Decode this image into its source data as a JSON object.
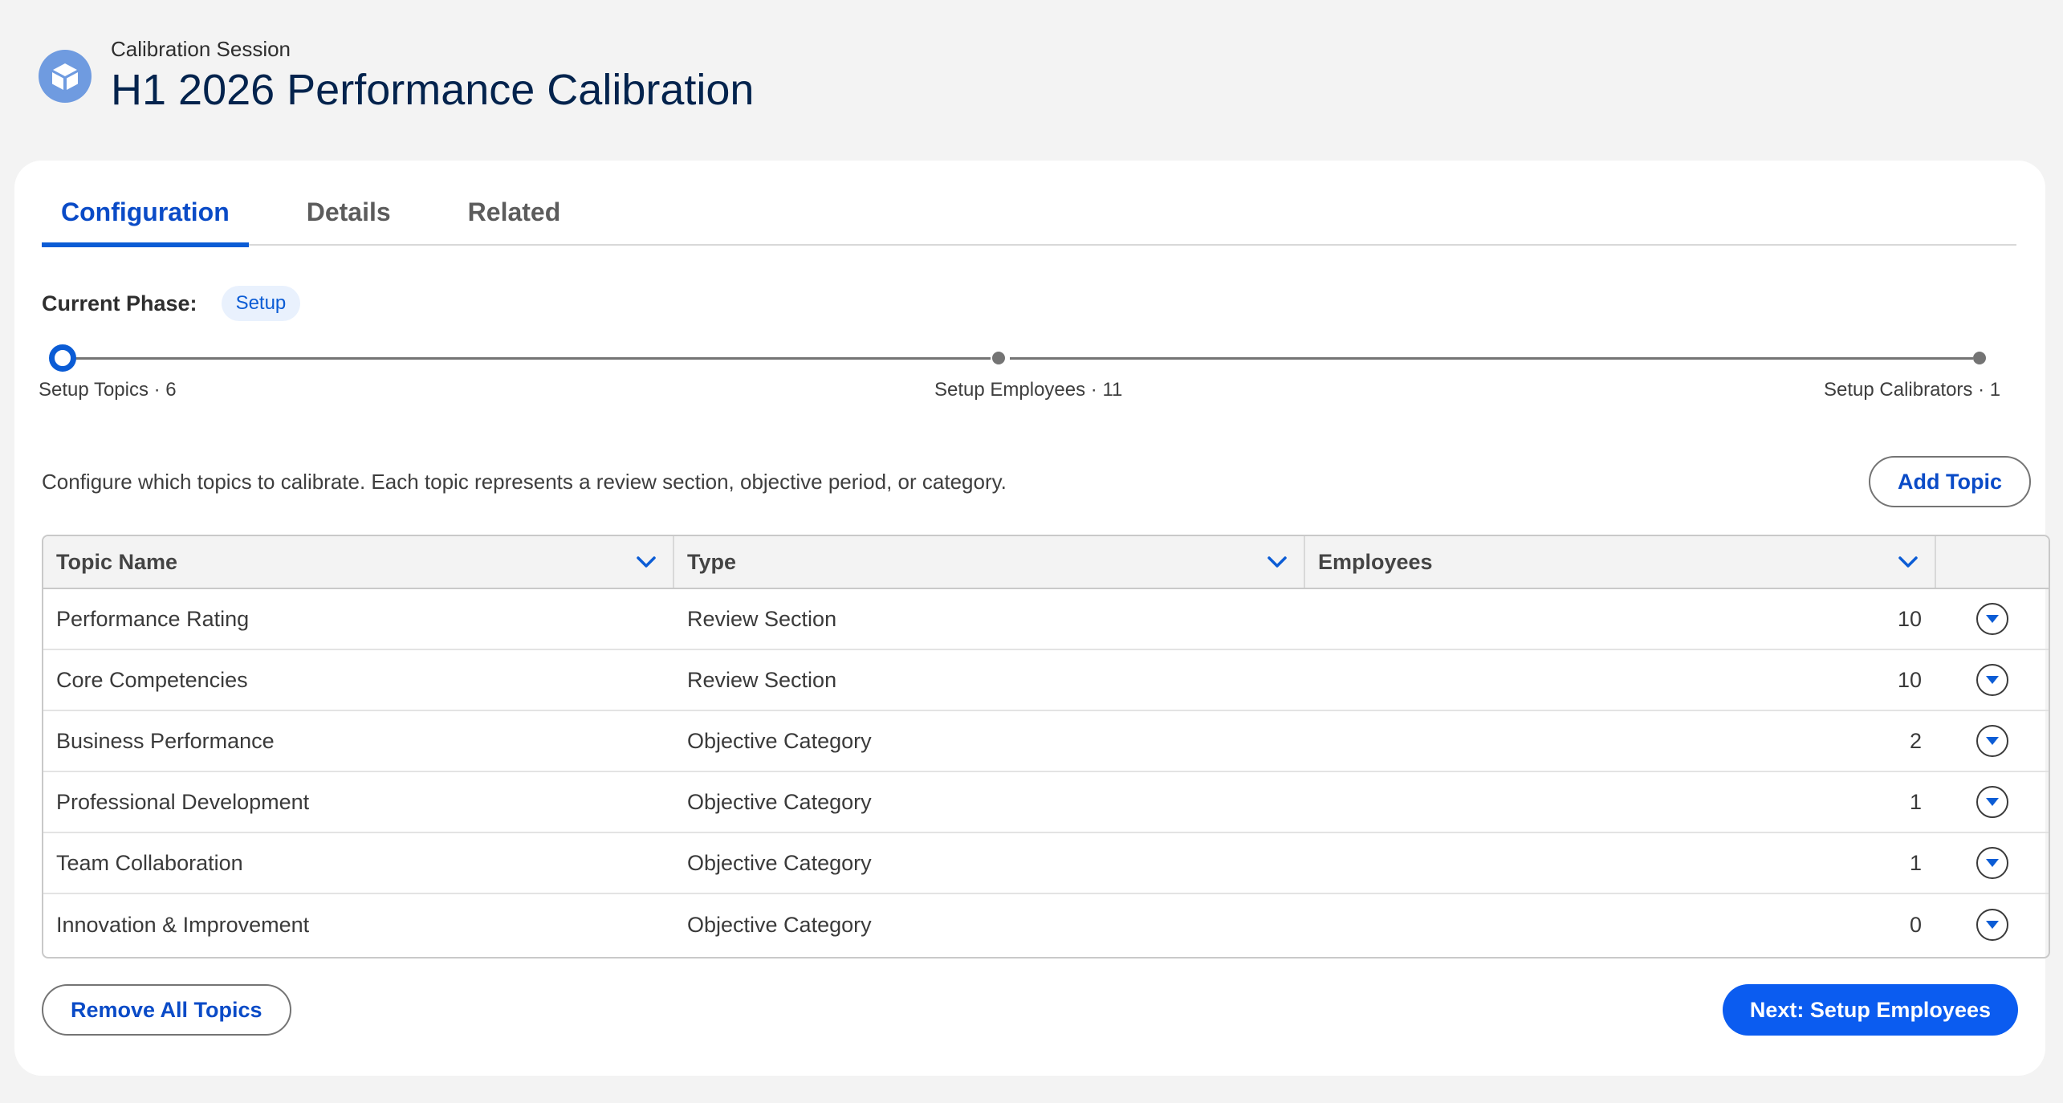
{
  "header": {
    "eyebrow": "Calibration Session",
    "title": "H1 2026 Performance Calibration",
    "icon": "cube-icon"
  },
  "tabs": [
    {
      "label": "Configuration",
      "active": true
    },
    {
      "label": "Details",
      "active": false
    },
    {
      "label": "Related",
      "active": false
    }
  ],
  "phase": {
    "label": "Current Phase:",
    "value": "Setup"
  },
  "steps": [
    {
      "label": "Setup Topics · 6",
      "current": true
    },
    {
      "label": "Setup Employees · 11",
      "current": false
    },
    {
      "label": "Setup Calibrators · 1",
      "current": false
    }
  ],
  "description": "Configure which topics to calibrate. Each topic represents a review section, objective period, or category.",
  "add_topic_label": "Add Topic",
  "table": {
    "columns": [
      "Topic Name",
      "Type",
      "Employees"
    ],
    "rows": [
      {
        "name": "Performance Rating",
        "type": "Review Section",
        "employees": "10"
      },
      {
        "name": "Core Competencies",
        "type": "Review Section",
        "employees": "10"
      },
      {
        "name": "Business Performance",
        "type": "Objective Category",
        "employees": "2"
      },
      {
        "name": "Professional Development",
        "type": "Objective Category",
        "employees": "1"
      },
      {
        "name": "Team Collaboration",
        "type": "Objective Category",
        "employees": "1"
      },
      {
        "name": "Innovation & Improvement",
        "type": "Objective Category",
        "employees": "0"
      }
    ]
  },
  "footer": {
    "remove_label": "Remove All Topics",
    "next_label": "Next: Setup Employees"
  },
  "colors": {
    "accent": "#0b5cd5",
    "primary_button": "#0b5cf0",
    "title": "#03234d"
  }
}
